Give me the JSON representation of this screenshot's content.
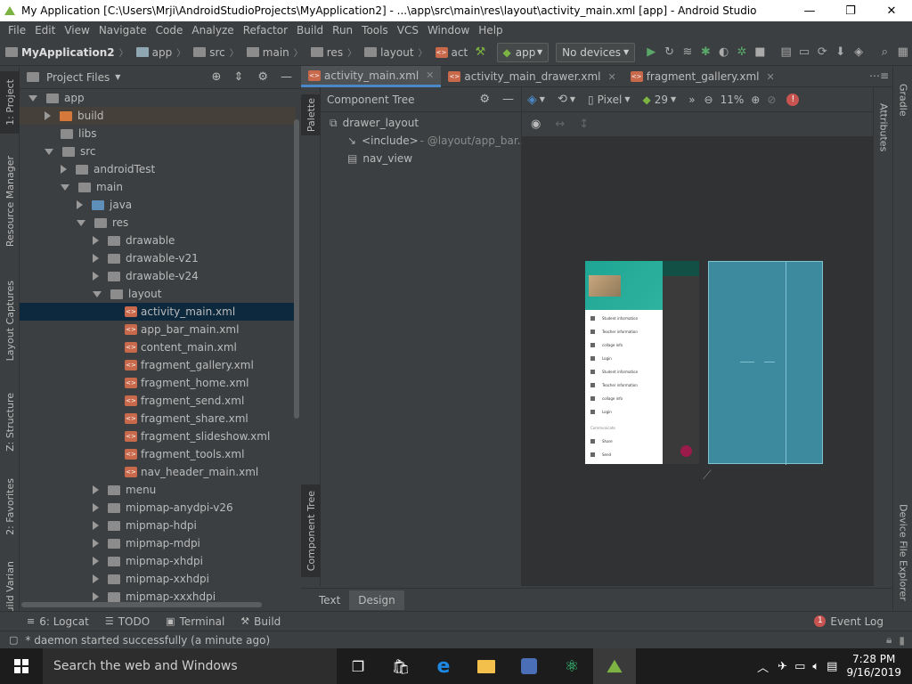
{
  "window": {
    "title": "My Application [C:\\Users\\Mrji\\AndroidStudioProjects\\MyApplication2] - ...\\app\\src\\main\\res\\layout\\activity_main.xml [app] - Android Studio",
    "minimize": "—",
    "maximize": "❐",
    "close": "✕"
  },
  "menu": [
    "File",
    "Edit",
    "View",
    "Navigate",
    "Code",
    "Analyze",
    "Refactor",
    "Build",
    "Run",
    "Tools",
    "VCS",
    "Window",
    "Help"
  ],
  "breadcrumbs": [
    "MyApplication2",
    "app",
    "src",
    "main",
    "res",
    "layout",
    "act"
  ],
  "toolbar": {
    "run_config": "app",
    "device": "No devices"
  },
  "left_tools": [
    "1: Project",
    "Resource Manager",
    "Layout Captures",
    "Z: Structure",
    "2: Favorites",
    "Build Variants"
  ],
  "project_panel": {
    "title": "Project Files",
    "tree": [
      {
        "label": "app",
        "depth": 1,
        "state": "open",
        "type": "folder"
      },
      {
        "label": "build",
        "depth": 2,
        "state": "closed",
        "type": "folder-orange"
      },
      {
        "label": "libs",
        "depth": 2,
        "state": "none",
        "type": "folder"
      },
      {
        "label": "src",
        "depth": 2,
        "state": "open",
        "type": "folder"
      },
      {
        "label": "androidTest",
        "depth": 3,
        "state": "closed",
        "type": "folder"
      },
      {
        "label": "main",
        "depth": 3,
        "state": "open",
        "type": "folder"
      },
      {
        "label": "java",
        "depth": 4,
        "state": "closed",
        "type": "folder-blue"
      },
      {
        "label": "res",
        "depth": 4,
        "state": "open",
        "type": "folder-res"
      },
      {
        "label": "drawable",
        "depth": 5,
        "state": "closed",
        "type": "folder"
      },
      {
        "label": "drawable-v21",
        "depth": 5,
        "state": "closed",
        "type": "folder"
      },
      {
        "label": "drawable-v24",
        "depth": 5,
        "state": "closed",
        "type": "folder"
      },
      {
        "label": "layout",
        "depth": 5,
        "state": "open",
        "type": "folder"
      },
      {
        "label": "activity_main.xml",
        "depth": 6,
        "state": "file",
        "type": "xml",
        "selected": true
      },
      {
        "label": "app_bar_main.xml",
        "depth": 6,
        "state": "file",
        "type": "xml"
      },
      {
        "label": "content_main.xml",
        "depth": 6,
        "state": "file",
        "type": "xml"
      },
      {
        "label": "fragment_gallery.xml",
        "depth": 6,
        "state": "file",
        "type": "xml"
      },
      {
        "label": "fragment_home.xml",
        "depth": 6,
        "state": "file",
        "type": "xml"
      },
      {
        "label": "fragment_send.xml",
        "depth": 6,
        "state": "file",
        "type": "xml"
      },
      {
        "label": "fragment_share.xml",
        "depth": 6,
        "state": "file",
        "type": "xml"
      },
      {
        "label": "fragment_slideshow.xml",
        "depth": 6,
        "state": "file",
        "type": "xml"
      },
      {
        "label": "fragment_tools.xml",
        "depth": 6,
        "state": "file",
        "type": "xml"
      },
      {
        "label": "nav_header_main.xml",
        "depth": 6,
        "state": "file",
        "type": "xml"
      },
      {
        "label": "menu",
        "depth": 5,
        "state": "closed",
        "type": "folder"
      },
      {
        "label": "mipmap-anydpi-v26",
        "depth": 5,
        "state": "closed",
        "type": "folder"
      },
      {
        "label": "mipmap-hdpi",
        "depth": 5,
        "state": "closed",
        "type": "folder"
      },
      {
        "label": "mipmap-mdpi",
        "depth": 5,
        "state": "closed",
        "type": "folder"
      },
      {
        "label": "mipmap-xhdpi",
        "depth": 5,
        "state": "closed",
        "type": "folder"
      },
      {
        "label": "mipmap-xxhdpi",
        "depth": 5,
        "state": "closed",
        "type": "folder"
      },
      {
        "label": "mipmap-xxxhdpi",
        "depth": 5,
        "state": "closed",
        "type": "folder"
      }
    ]
  },
  "editor_tabs": [
    {
      "label": "activity_main.xml",
      "active": true
    },
    {
      "label": "activity_main_drawer.xml",
      "active": false
    },
    {
      "label": "fragment_gallery.xml",
      "active": false
    }
  ],
  "palette_label": "Palette",
  "component_tree": {
    "title": "Component Tree",
    "side_label": "Component Tree",
    "items": [
      {
        "label": "drawer_layout",
        "extra": ""
      },
      {
        "label": "<include>",
        "extra": "- @layout/app_bar..."
      },
      {
        "label": "nav_view",
        "extra": ""
      }
    ]
  },
  "design_toolbar": {
    "device": "Pixel",
    "api": "29",
    "zoom": "11%"
  },
  "preview": {
    "menu_items": [
      "Student information",
      "Teacher information",
      "collage info",
      "Login",
      "Student information",
      "Teacher information",
      "collage info",
      "Login"
    ],
    "section": "Communicate",
    "section_items": [
      "Share",
      "Send"
    ]
  },
  "right_tools": [
    "Gradle",
    "Attributes",
    "Device File Explorer"
  ],
  "bottom_tabs": [
    "Text",
    "Design"
  ],
  "bottom_tools": [
    {
      "icon": "≡",
      "label": "6: Logcat"
    },
    {
      "icon": "☰",
      "label": "TODO"
    },
    {
      "icon": "▣",
      "label": "Terminal"
    },
    {
      "icon": "⚒",
      "label": "Build"
    }
  ],
  "event_log": {
    "count": "1",
    "label": "Event Log"
  },
  "status_text": "* daemon started successfully (a minute ago)",
  "taskbar": {
    "search_placeholder": "Search the web and Windows",
    "time": "7:28 PM",
    "date": "9/16/2019"
  },
  "colors": {
    "accent": "#4a88c7",
    "teal": "#2e7d84",
    "preview_blue": "#3f8a9c",
    "header_teal": "#1fa593"
  }
}
